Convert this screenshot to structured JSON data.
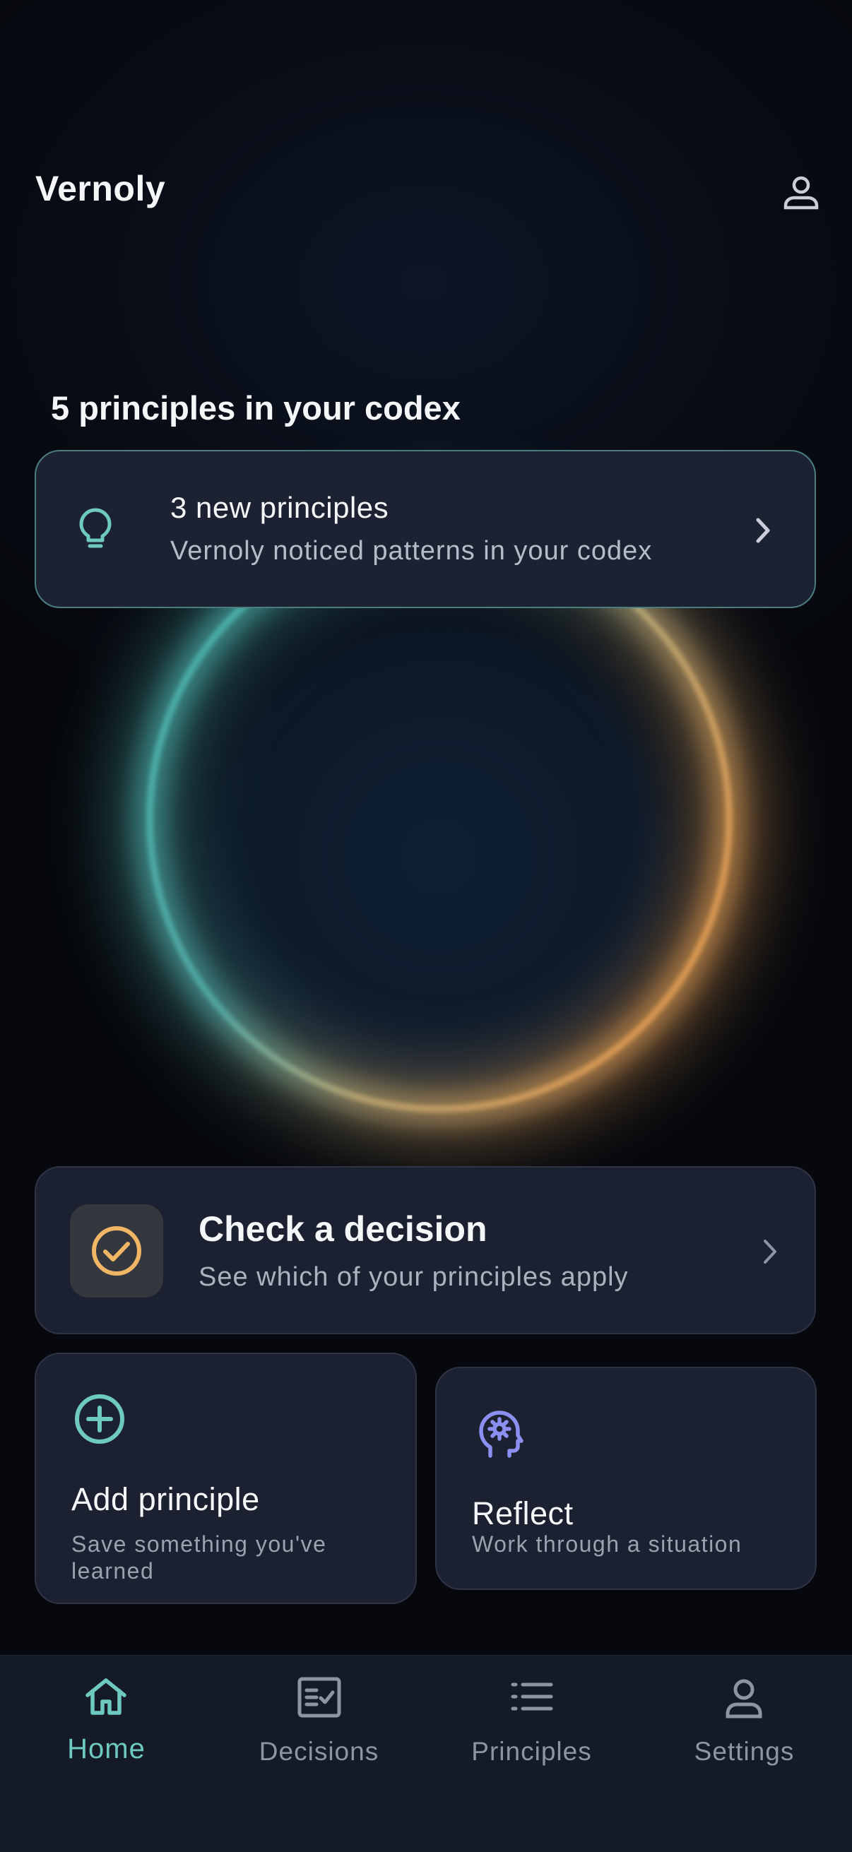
{
  "header": {
    "app_title": "Vernoly",
    "profile_icon": "person-icon"
  },
  "codex": {
    "count_text": "5 principles in your codex"
  },
  "insight": {
    "title": "3 new principles",
    "subtitle": "Vernoly noticed patterns in your codex",
    "icon": "lightbulb-icon"
  },
  "decision": {
    "title": "Check a decision",
    "subtitle": "See which of your principles apply",
    "icon": "check-circle-icon"
  },
  "add_principle": {
    "title": "Add principle",
    "subtitle": "Save something you've learned",
    "icon": "plus-circle-icon"
  },
  "reflect": {
    "title": "Reflect",
    "subtitle": "Work through a situation",
    "icon": "head-gear-icon"
  },
  "nav": {
    "items": [
      {
        "label": "Home",
        "icon": "home-icon",
        "active": true
      },
      {
        "label": "Decisions",
        "icon": "checklist-icon",
        "active": false
      },
      {
        "label": "Principles",
        "icon": "list-icon",
        "active": false
      },
      {
        "label": "Settings",
        "icon": "person-icon",
        "active": false
      }
    ]
  },
  "colors": {
    "accent_teal": "#6ec9c0",
    "accent_amber": "#f0b565",
    "accent_violet": "#8b8ff0",
    "card_bg": "#1c2131",
    "nav_bg": "#151a27"
  }
}
